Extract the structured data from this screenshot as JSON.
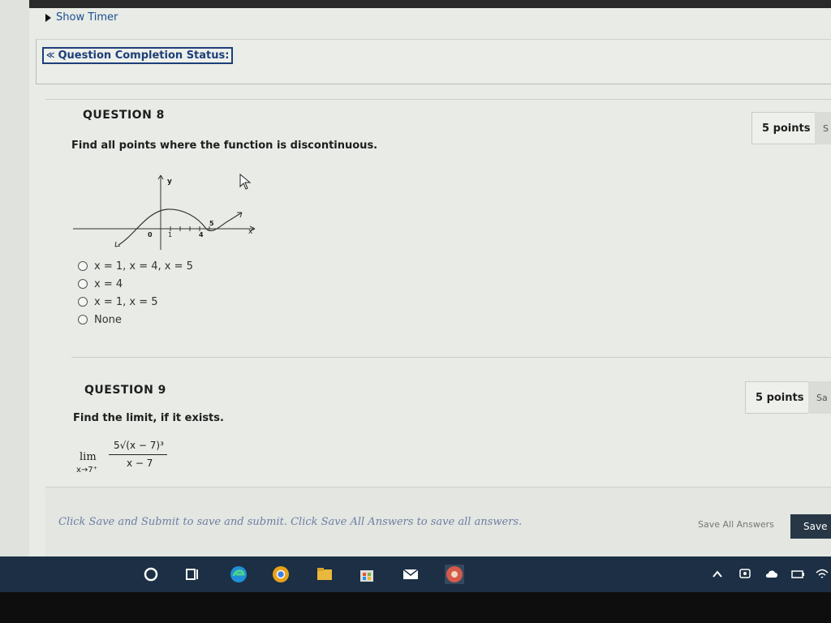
{
  "timer": {
    "label": "Show Timer"
  },
  "completion": {
    "label": "Question Completion Status:"
  },
  "questions": [
    {
      "title": "QUESTION 8",
      "points": "5 points",
      "points_extra": "S",
      "prompt": "Find all points where the function is discontinuous.",
      "graph": {
        "y_label": "y",
        "x_label": "x",
        "ticks": [
          "0",
          "1",
          "4",
          "5"
        ]
      },
      "choices": [
        "x = 1, x = 4, x = 5",
        "x = 4",
        "x = 1, x = 5",
        "None"
      ]
    },
    {
      "title": "QUESTION 9",
      "points": "5 points",
      "points_extra": "Sa",
      "prompt": "Find the limit, if it exists.",
      "limit": {
        "lim": "lim",
        "sub": "x→7⁺",
        "numerator": "5√(x − 7)³",
        "denominator": "x − 7"
      }
    }
  ],
  "footer": {
    "note": "Click Save and Submit to save and submit. Click Save All Answers to save all answers.",
    "save_all": "Save All Answers",
    "save_submit": "Save a"
  },
  "taskbar": {
    "color": "#1c2f44",
    "icons": [
      "search-icon",
      "task-view-icon",
      "edge-icon",
      "chrome-icon",
      "file-explorer-icon",
      "store-icon",
      "mail-icon",
      "app-icon"
    ],
    "tray": [
      "chevron-up-icon",
      "meet-icon",
      "cloud-icon",
      "battery-icon",
      "wifi-icon"
    ]
  }
}
